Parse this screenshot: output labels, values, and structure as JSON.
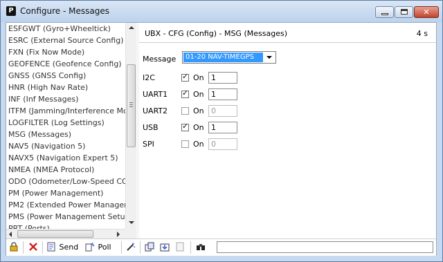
{
  "window": {
    "title": "Configure - Messages",
    "app_icon_letter": "P",
    "close_glyph": "✕"
  },
  "message_list": {
    "items": [
      "ESFGWT (Gyro+Wheeltick)",
      "ESRC (External Source Config)",
      "FXN (Fix Now Mode)",
      "GEOFENCE (Geofence Config)",
      "GNSS (GNSS Config)",
      "HNR (High Nav Rate)",
      "INF (Inf Messages)",
      "ITFM (Jamming/Interference Mo",
      "LOGFILTER (Log Settings)",
      "MSG (Messages)",
      "NAV5 (Navigation 5)",
      "NAVX5 (Navigation Expert 5)",
      "NMEA (NMEA Protocol)",
      "ODO (Odometer/Low-Speed CO",
      "PM (Power Management)",
      "PM2 (Extended Power Managem",
      "PMS (Power Management Setup",
      "PRT (Ports)"
    ],
    "selected": "MSG (Messages)"
  },
  "panel": {
    "header": "UBX - CFG (Config) - MSG (Messages)",
    "age": "4 s",
    "message_label": "Message",
    "message_value": "01-20 NAV-TIMEGPS",
    "on_label": "On",
    "ports": [
      {
        "name": "I2C",
        "checked": true,
        "rate": "1",
        "enabled": true
      },
      {
        "name": "UART1",
        "checked": true,
        "rate": "1",
        "enabled": true
      },
      {
        "name": "UART2",
        "checked": false,
        "rate": "0",
        "enabled": false
      },
      {
        "name": "USB",
        "checked": true,
        "rate": "1",
        "enabled": true
      },
      {
        "name": "SPI",
        "checked": false,
        "rate": "0",
        "enabled": false
      }
    ]
  },
  "toolbar": {
    "send_label": "Send",
    "poll_label": "Poll",
    "status_text": ""
  },
  "colors": {
    "selection": "#3399ff",
    "titlebar": "#c6d9ee",
    "close_button": "#c2432d"
  }
}
